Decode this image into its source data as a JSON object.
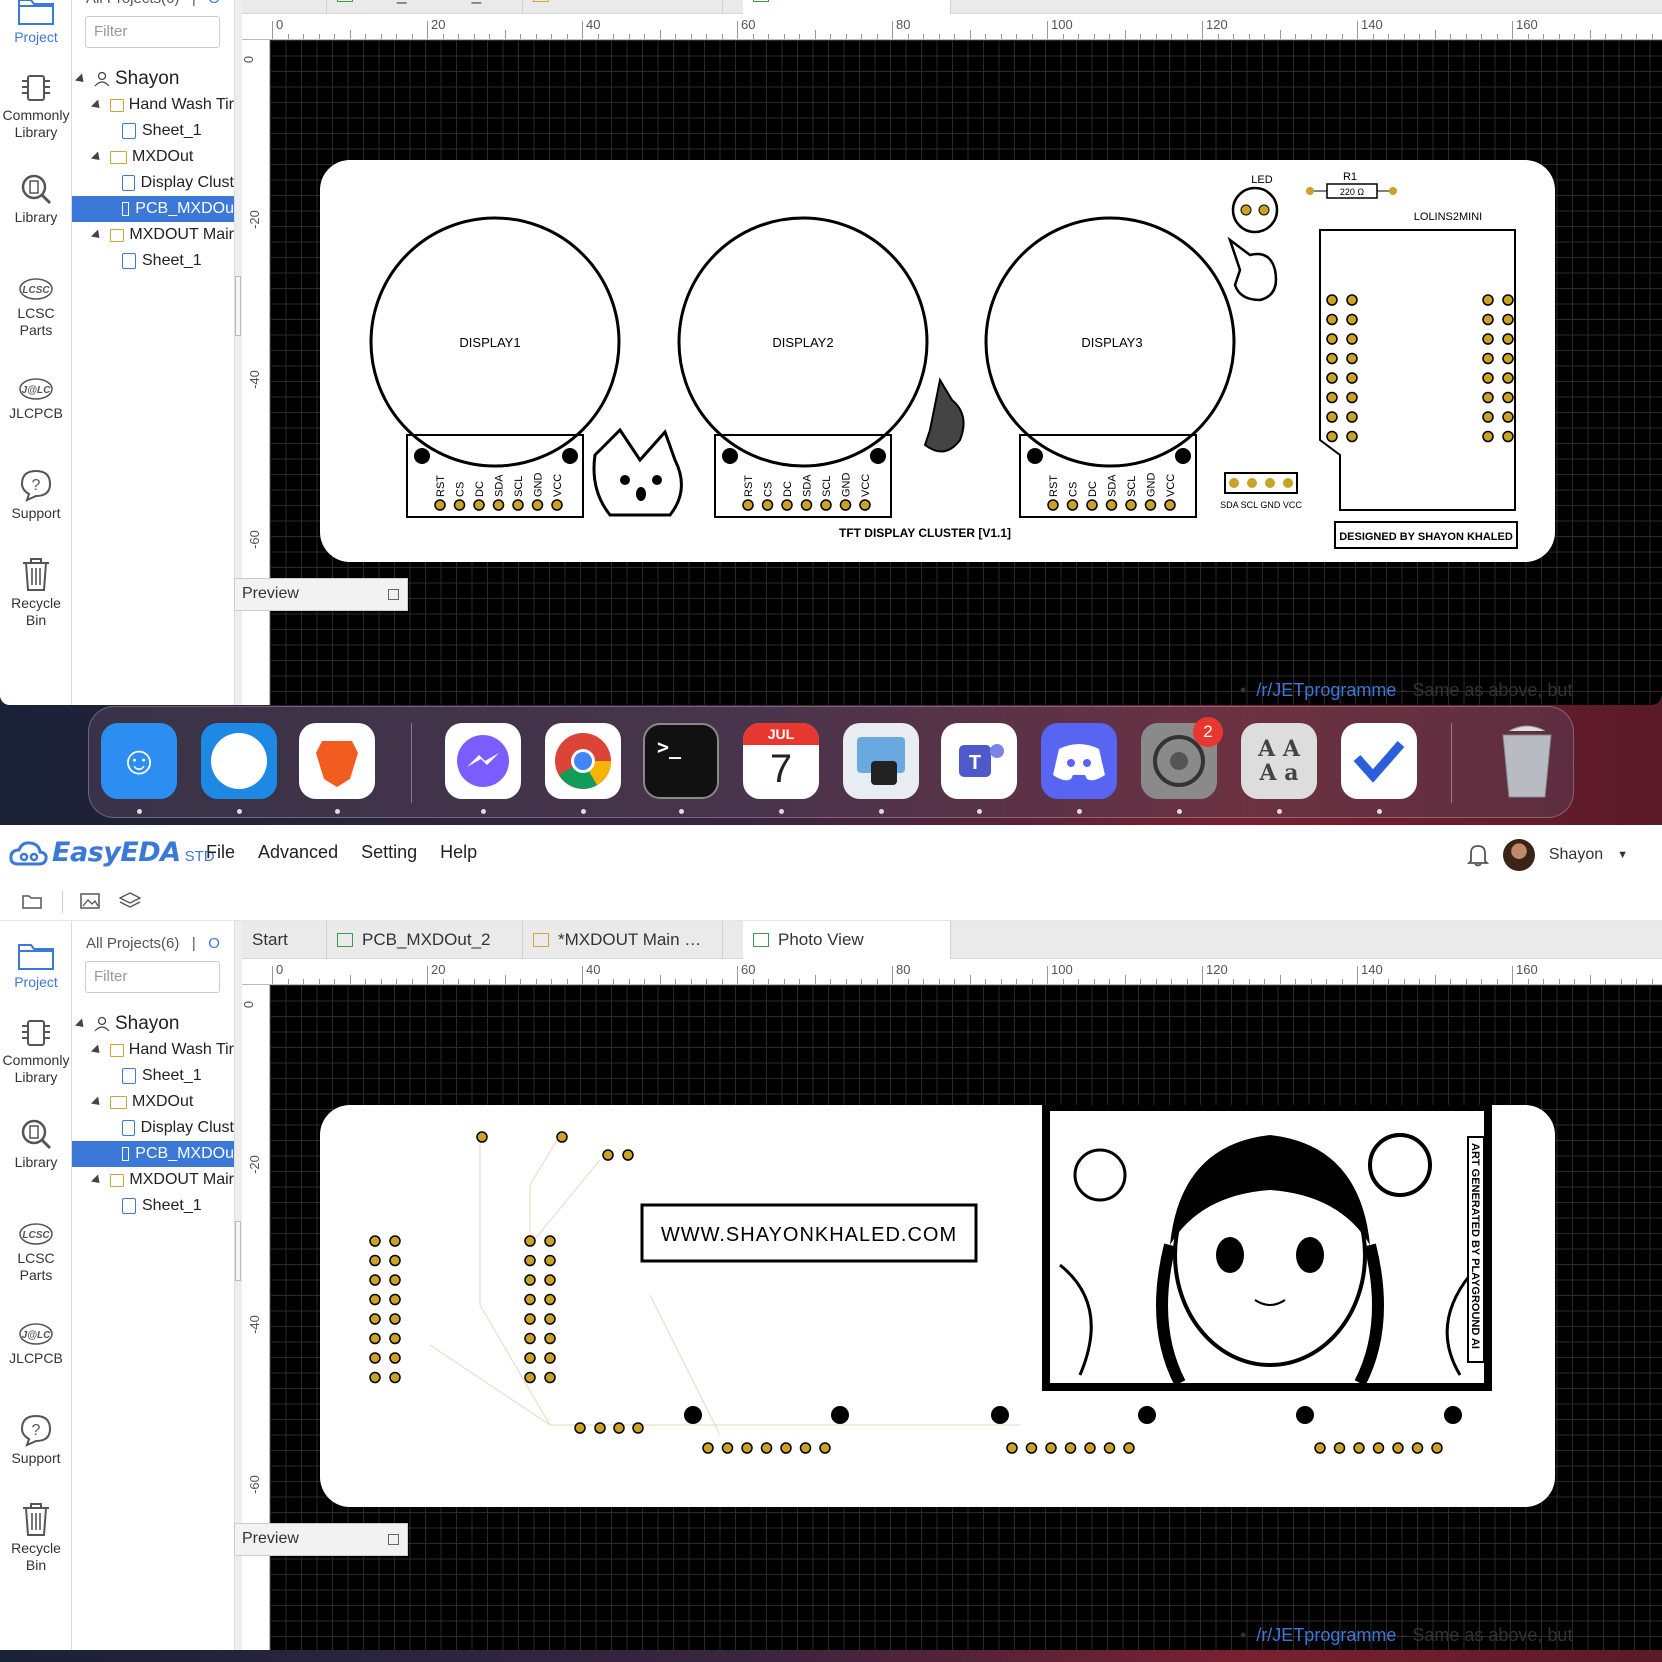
{
  "app": {
    "logo": "EasyEDA",
    "edition": "STD"
  },
  "menu": [
    "File",
    "Advanced",
    "Setting",
    "Help"
  ],
  "user": {
    "name": "Shayon"
  },
  "nav": [
    {
      "label": "Project",
      "icon": "folder-icon"
    },
    {
      "label": "Commonly Library",
      "icon": "chip-icon"
    },
    {
      "label": "Library",
      "icon": "library-search-icon"
    },
    {
      "label": "LCSC Parts",
      "icon": "lcsc-icon"
    },
    {
      "label": "JLCPCB",
      "icon": "jlcpcb-icon"
    },
    {
      "label": "Support",
      "icon": "help-icon"
    },
    {
      "label": "Recycle Bin",
      "icon": "trash-icon"
    }
  ],
  "tree": {
    "all_projects": "All Projects(6)",
    "other": "O",
    "filter_placeholder": "Filter",
    "items": [
      "Shayon",
      "Hand Wash Tir",
      "Sheet_1",
      "MXDOut",
      "Display Clust",
      "PCB_MXDOu",
      "MXDOUT Mair",
      "Sheet_1"
    ]
  },
  "tabs": [
    "Start",
    "PCB_MXDOut_2",
    "*MXDOUT Main …",
    "Photo View"
  ],
  "ruler": {
    "h": [
      "0",
      "20",
      "40",
      "60",
      "80",
      "100",
      "120",
      "140",
      "160"
    ],
    "v": [
      "0",
      "-20",
      "-40",
      "-60"
    ]
  },
  "preview": {
    "label": "Preview"
  },
  "background_page": {
    "link": "/r/JETprogramme",
    "text": " - Same as above, but"
  },
  "board_top": {
    "displays": [
      "DISPLAY1",
      "DISPLAY2",
      "DISPLAY3"
    ],
    "pins": [
      "RST",
      "CS",
      "DC",
      "SDA",
      "SCL",
      "GND",
      "VCC"
    ],
    "led": "LED",
    "r1": "R1",
    "r1_value": "220 Ω",
    "module": "LOLINS2MINI",
    "i2c_pins": "SDA SCL GND VCC",
    "title": "TFT DISPLAY CLUSTER [V1.1]",
    "designer": "DESIGNED BY SHAYON KHALED"
  },
  "board_bottom": {
    "website": "WWW.SHAYONKHALED.COM",
    "art_credit": "ART GENERATED BY PLAYGROUND AI"
  },
  "dock": [
    {
      "name": "Finder",
      "color": "#2d8ef2"
    },
    {
      "name": "Safari",
      "color": "#1e88e5"
    },
    {
      "name": "Brave",
      "color": "#fff"
    },
    {
      "name": "Messenger",
      "color": "#fff"
    },
    {
      "name": "Chrome",
      "color": "#fff"
    },
    {
      "name": "Terminal",
      "color": "#111"
    },
    {
      "name": "Calendar",
      "color": "#fff",
      "month": "JUL",
      "day": "7"
    },
    {
      "name": "Preview",
      "color": "#e8edf2"
    },
    {
      "name": "Teams",
      "color": "#fff"
    },
    {
      "name": "Discord",
      "color": "#5865f2"
    },
    {
      "name": "System Settings",
      "color": "#8a8a8a",
      "badge": "2"
    },
    {
      "name": "Dictionary",
      "color": "#ddd",
      "glyph": "A A\nA a"
    },
    {
      "name": "Toolbox",
      "color": "#fff"
    },
    {
      "name": "Trash",
      "color": "transparent"
    }
  ]
}
